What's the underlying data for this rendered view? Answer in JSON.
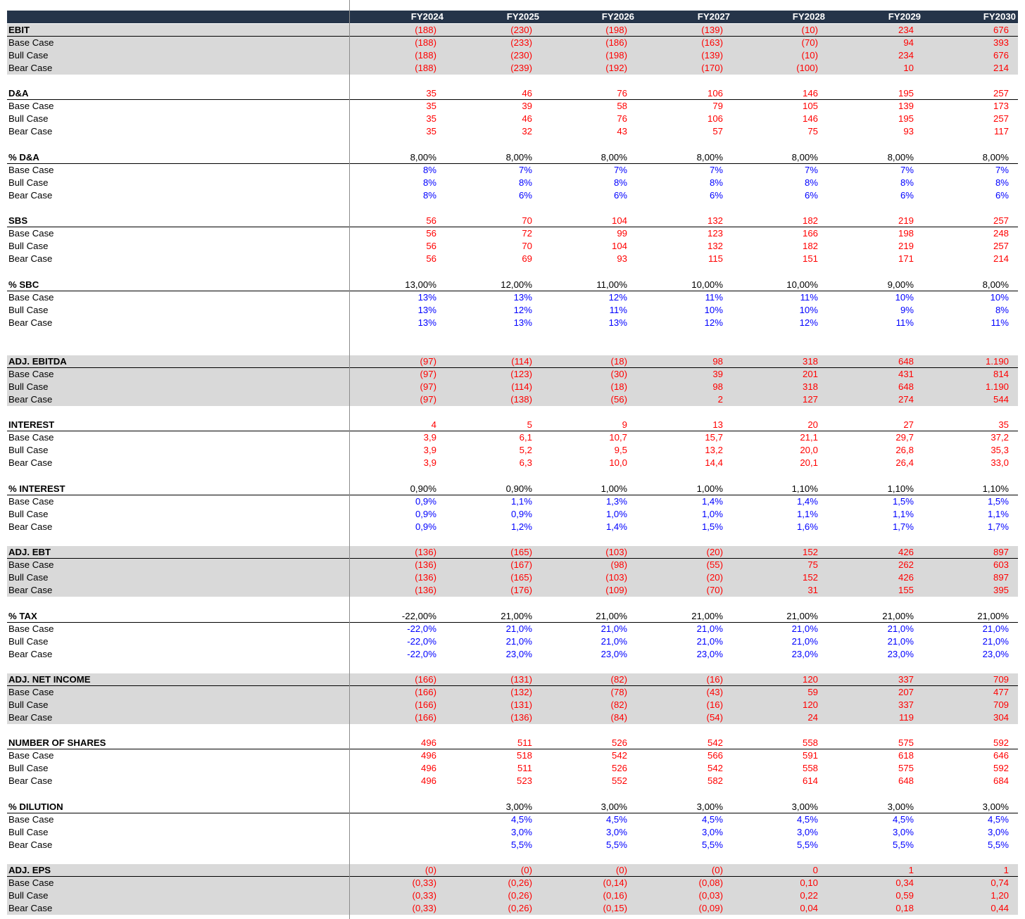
{
  "header": {
    "years": [
      "FY2024",
      "FY2025",
      "FY2026",
      "FY2027",
      "FY2028",
      "FY2029",
      "FY2030"
    ]
  },
  "colors": {
    "header_bg": "#253449",
    "shade": "#d9d9d9",
    "red": "#ff0000",
    "blue": "#0000ff",
    "black": "#000000"
  },
  "sections": [
    {
      "title": "EBIT",
      "shaded": true,
      "total_color": "red",
      "case_color": "red",
      "total": [
        "(188)",
        "(230)",
        "(198)",
        "(139)",
        "(10)",
        "234",
        "676"
      ],
      "cases": [
        {
          "label": "Base Case",
          "values": [
            "(188)",
            "(233)",
            "(186)",
            "(163)",
            "(70)",
            "94",
            "393"
          ]
        },
        {
          "label": "Bull Case",
          "values": [
            "(188)",
            "(230)",
            "(198)",
            "(139)",
            "(10)",
            "234",
            "676"
          ]
        },
        {
          "label": "Bear Case",
          "values": [
            "(188)",
            "(239)",
            "(192)",
            "(170)",
            "(100)",
            "10",
            "214"
          ]
        }
      ]
    },
    {
      "title": "D&A",
      "shaded": false,
      "total_color": "red",
      "case_color": "red",
      "total": [
        "35",
        "46",
        "76",
        "106",
        "146",
        "195",
        "257"
      ],
      "cases": [
        {
          "label": "Base Case",
          "values": [
            "35",
            "39",
            "58",
            "79",
            "105",
            "139",
            "173"
          ]
        },
        {
          "label": "Bull Case",
          "values": [
            "35",
            "46",
            "76",
            "106",
            "146",
            "195",
            "257"
          ]
        },
        {
          "label": "Bear Case",
          "values": [
            "35",
            "32",
            "43",
            "57",
            "75",
            "93",
            "117"
          ]
        }
      ]
    },
    {
      "title": "% D&A",
      "shaded": false,
      "total_color": "black",
      "case_color": "blue",
      "total": [
        "8,00%",
        "8,00%",
        "8,00%",
        "8,00%",
        "8,00%",
        "8,00%",
        "8,00%"
      ],
      "cases": [
        {
          "label": "Base Case",
          "values": [
            "8%",
            "7%",
            "7%",
            "7%",
            "7%",
            "7%",
            "7%"
          ]
        },
        {
          "label": "Bull Case",
          "values": [
            "8%",
            "8%",
            "8%",
            "8%",
            "8%",
            "8%",
            "8%"
          ]
        },
        {
          "label": "Bear Case",
          "values": [
            "8%",
            "6%",
            "6%",
            "6%",
            "6%",
            "6%",
            "6%"
          ]
        }
      ]
    },
    {
      "title": "SBS",
      "shaded": false,
      "total_color": "red",
      "case_color": "red",
      "total": [
        "56",
        "70",
        "104",
        "132",
        "182",
        "219",
        "257"
      ],
      "cases": [
        {
          "label": "Base Case",
          "values": [
            "56",
            "72",
            "99",
            "123",
            "166",
            "198",
            "248"
          ]
        },
        {
          "label": "Bull Case",
          "values": [
            "56",
            "70",
            "104",
            "132",
            "182",
            "219",
            "257"
          ]
        },
        {
          "label": "Bear Case",
          "values": [
            "56",
            "69",
            "93",
            "115",
            "151",
            "171",
            "214"
          ]
        }
      ]
    },
    {
      "title": "% SBC",
      "shaded": false,
      "total_color": "black",
      "case_color": "blue",
      "total": [
        "13,00%",
        "12,00%",
        "11,00%",
        "10,00%",
        "10,00%",
        "9,00%",
        "8,00%"
      ],
      "cases": [
        {
          "label": "Base Case",
          "values": [
            "13%",
            "13%",
            "12%",
            "11%",
            "11%",
            "10%",
            "10%"
          ]
        },
        {
          "label": "Bull Case",
          "values": [
            "13%",
            "12%",
            "11%",
            "10%",
            "10%",
            "9%",
            "8%"
          ]
        },
        {
          "label": "Bear Case",
          "values": [
            "13%",
            "13%",
            "13%",
            "12%",
            "12%",
            "11%",
            "11%"
          ]
        }
      ]
    },
    {
      "title": "ADJ. EBITDA",
      "shaded": true,
      "total_color": "red",
      "case_color": "red",
      "total": [
        "(97)",
        "(114)",
        "(18)",
        "98",
        "318",
        "648",
        "1.190"
      ],
      "cases": [
        {
          "label": "Base Case",
          "values": [
            "(97)",
            "(123)",
            "(30)",
            "39",
            "201",
            "431",
            "814"
          ]
        },
        {
          "label": "Bull Case",
          "values": [
            "(97)",
            "(114)",
            "(18)",
            "98",
            "318",
            "648",
            "1.190"
          ]
        },
        {
          "label": "Bear Case",
          "values": [
            "(97)",
            "(138)",
            "(56)",
            "2",
            "127",
            "274",
            "544"
          ]
        }
      ]
    },
    {
      "title": "INTEREST",
      "shaded": false,
      "total_color": "red",
      "case_color": "red",
      "total": [
        "4",
        "5",
        "9",
        "13",
        "20",
        "27",
        "35"
      ],
      "cases": [
        {
          "label": "Base Case",
          "values": [
            "3,9",
            "6,1",
            "10,7",
            "15,7",
            "21,1",
            "29,7",
            "37,2"
          ]
        },
        {
          "label": "Bull Case",
          "values": [
            "3,9",
            "5,2",
            "9,5",
            "13,2",
            "20,0",
            "26,8",
            "35,3"
          ]
        },
        {
          "label": "Bear Case",
          "values": [
            "3,9",
            "6,3",
            "10,0",
            "14,4",
            "20,1",
            "26,4",
            "33,0"
          ]
        }
      ]
    },
    {
      "title": "% INTEREST",
      "shaded": false,
      "total_color": "black",
      "case_color": "blue",
      "total": [
        "0,90%",
        "0,90%",
        "1,00%",
        "1,00%",
        "1,10%",
        "1,10%",
        "1,10%"
      ],
      "cases": [
        {
          "label": "Base Case",
          "values": [
            "0,9%",
            "1,1%",
            "1,3%",
            "1,4%",
            "1,4%",
            "1,5%",
            "1,5%"
          ]
        },
        {
          "label": "Bull Case",
          "values": [
            "0,9%",
            "0,9%",
            "1,0%",
            "1,0%",
            "1,1%",
            "1,1%",
            "1,1%"
          ]
        },
        {
          "label": "Bear Case",
          "values": [
            "0,9%",
            "1,2%",
            "1,4%",
            "1,5%",
            "1,6%",
            "1,7%",
            "1,7%"
          ]
        }
      ]
    },
    {
      "title": "ADJ. EBT",
      "shaded": true,
      "total_color": "red",
      "case_color": "red",
      "total": [
        "(136)",
        "(165)",
        "(103)",
        "(20)",
        "152",
        "426",
        "897"
      ],
      "cases": [
        {
          "label": "Base Case",
          "values": [
            "(136)",
            "(167)",
            "(98)",
            "(55)",
            "75",
            "262",
            "603"
          ]
        },
        {
          "label": "Bull Case",
          "values": [
            "(136)",
            "(165)",
            "(103)",
            "(20)",
            "152",
            "426",
            "897"
          ]
        },
        {
          "label": "Bear Case",
          "values": [
            "(136)",
            "(176)",
            "(109)",
            "(70)",
            "31",
            "155",
            "395"
          ]
        }
      ]
    },
    {
      "title": "% TAX",
      "shaded": false,
      "total_color": "black",
      "case_color": "blue",
      "total": [
        "-22,00%",
        "21,00%",
        "21,00%",
        "21,00%",
        "21,00%",
        "21,00%",
        "21,00%"
      ],
      "cases": [
        {
          "label": "Base Case",
          "values": [
            "-22,0%",
            "21,0%",
            "21,0%",
            "21,0%",
            "21,0%",
            "21,0%",
            "21,0%"
          ]
        },
        {
          "label": "Bull Case",
          "values": [
            "-22,0%",
            "21,0%",
            "21,0%",
            "21,0%",
            "21,0%",
            "21,0%",
            "21,0%"
          ]
        },
        {
          "label": "Bear Case",
          "values": [
            "-22,0%",
            "23,0%",
            "23,0%",
            "23,0%",
            "23,0%",
            "23,0%",
            "23,0%"
          ]
        }
      ]
    },
    {
      "title": "ADJ. NET INCOME",
      "shaded": true,
      "total_color": "red",
      "case_color": "red",
      "total": [
        "(166)",
        "(131)",
        "(82)",
        "(16)",
        "120",
        "337",
        "709"
      ],
      "cases": [
        {
          "label": "Base Case",
          "values": [
            "(166)",
            "(132)",
            "(78)",
            "(43)",
            "59",
            "207",
            "477"
          ]
        },
        {
          "label": "Bull Case",
          "values": [
            "(166)",
            "(131)",
            "(82)",
            "(16)",
            "120",
            "337",
            "709"
          ]
        },
        {
          "label": "Bear Case",
          "values": [
            "(166)",
            "(136)",
            "(84)",
            "(54)",
            "24",
            "119",
            "304"
          ]
        }
      ]
    },
    {
      "title": "NUMBER OF SHARES",
      "shaded": false,
      "total_color": "red",
      "case_color": "red",
      "total": [
        "496",
        "511",
        "526",
        "542",
        "558",
        "575",
        "592"
      ],
      "cases": [
        {
          "label": "Base Case",
          "values": [
            "496",
            "518",
            "542",
            "566",
            "591",
            "618",
            "646"
          ]
        },
        {
          "label": "Bull Case",
          "values": [
            "496",
            "511",
            "526",
            "542",
            "558",
            "575",
            "592"
          ]
        },
        {
          "label": "Bear Case",
          "values": [
            "496",
            "523",
            "552",
            "582",
            "614",
            "648",
            "684"
          ]
        }
      ]
    },
    {
      "title": "% DILUTION",
      "shaded": false,
      "total_color": "black",
      "case_color": "blue",
      "total": [
        "",
        "3,00%",
        "3,00%",
        "3,00%",
        "3,00%",
        "3,00%",
        "3,00%"
      ],
      "cases": [
        {
          "label": "Base Case",
          "values": [
            "",
            "4,5%",
            "4,5%",
            "4,5%",
            "4,5%",
            "4,5%",
            "4,5%"
          ]
        },
        {
          "label": "Bull Case",
          "values": [
            "",
            "3,0%",
            "3,0%",
            "3,0%",
            "3,0%",
            "3,0%",
            "3,0%"
          ]
        },
        {
          "label": "Bear Case",
          "values": [
            "",
            "5,5%",
            "5,5%",
            "5,5%",
            "5,5%",
            "5,5%",
            "5,5%"
          ]
        }
      ]
    },
    {
      "title": "ADJ. EPS",
      "shaded": true,
      "total_color": "red",
      "case_color": "red",
      "total": [
        "(0)",
        "(0)",
        "(0)",
        "(0)",
        "0",
        "1",
        "1"
      ],
      "cases": [
        {
          "label": "Base Case",
          "values": [
            "(0,33)",
            "(0,26)",
            "(0,14)",
            "(0,08)",
            "0,10",
            "0,34",
            "0,74"
          ]
        },
        {
          "label": "Bull Case",
          "values": [
            "(0,33)",
            "(0,26)",
            "(0,16)",
            "(0,03)",
            "0,22",
            "0,59",
            "1,20"
          ]
        },
        {
          "label": "Bear Case",
          "values": [
            "(0,33)",
            "(0,26)",
            "(0,15)",
            "(0,09)",
            "0,04",
            "0,18",
            "0,44"
          ]
        }
      ]
    }
  ]
}
